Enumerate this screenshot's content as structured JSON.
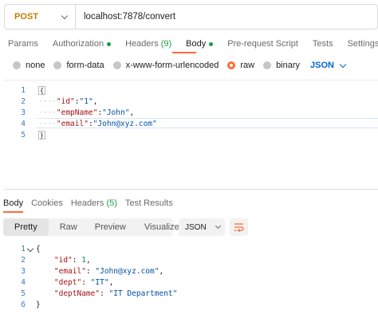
{
  "request": {
    "method": "POST",
    "url": "localhost:7878/convert"
  },
  "tabs": [
    {
      "label": "Params"
    },
    {
      "label": "Authorization"
    },
    {
      "label": "Headers",
      "count": "(9)"
    },
    {
      "label": "Body"
    },
    {
      "label": "Pre-request Script"
    },
    {
      "label": "Tests"
    },
    {
      "label": "Settings"
    }
  ],
  "body_types": [
    "none",
    "form-data",
    "x-www-form-urlencoded",
    "raw",
    "binary"
  ],
  "body_language": "JSON",
  "request_body": {
    "line_numbers": [
      "1",
      "2",
      "3",
      "4",
      "5"
    ],
    "lines": [
      {
        "text": "{"
      },
      {
        "key": "\"id\"",
        "value": "\"1\"",
        "tail": ","
      },
      {
        "key": "\"empName\"",
        "value": "\"John\"",
        "tail": ","
      },
      {
        "key": "\"email\"",
        "value": "\"John@xyz.com\"",
        "tail": ""
      },
      {
        "text": "}"
      }
    ]
  },
  "response_tabs": [
    {
      "label": "Body"
    },
    {
      "label": "Cookies"
    },
    {
      "label": "Headers",
      "count": "(5)"
    },
    {
      "label": "Test Results"
    }
  ],
  "view_modes": [
    "Pretty",
    "Raw",
    "Preview",
    "Visualize"
  ],
  "response_format": "JSON",
  "response_body": {
    "line_numbers": [
      "1",
      "2",
      "3",
      "4",
      "5",
      "6"
    ],
    "lines": [
      {
        "text": "{"
      },
      {
        "key": "\"id\"",
        "sep": ": ",
        "value": "1",
        "tail": ","
      },
      {
        "key": "\"email\"",
        "sep": ": ",
        "value": "\"John@xyz.com\"",
        "tail": ","
      },
      {
        "key": "\"dept\"",
        "sep": ": ",
        "value": "\"IT\"",
        "tail": ","
      },
      {
        "key": "\"deptName\"",
        "sep": ": ",
        "value": "\"IT Department\"",
        "tail": ""
      },
      {
        "text": "}"
      }
    ]
  },
  "colors": {
    "accent": "#ff6c37",
    "method": "#c07c00",
    "active_dot": "#1a9e3f",
    "json_key": "#a31515",
    "json_string": "#0451a5",
    "json_number": "#098658",
    "line_number": "#3b7bbf"
  }
}
